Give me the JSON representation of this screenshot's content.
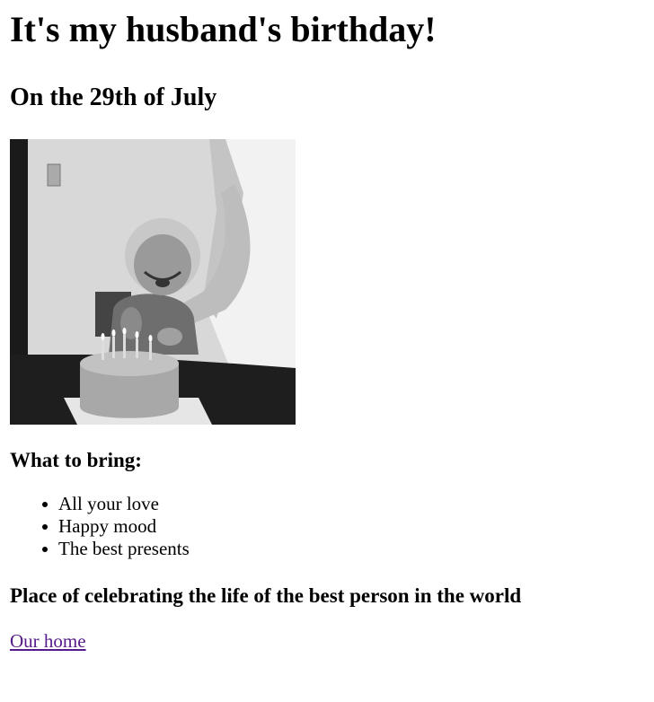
{
  "page": {
    "title": "It's my husband's birthday!",
    "date": "On the 29th of July",
    "photo_alt": "Black and white photo of a crying child in front of a birthday cake with candles",
    "bring_heading": "What to bring:",
    "bring_items": [
      "All your love",
      "Happy mood",
      "The best presents"
    ],
    "place_heading": "Place of celebrating the life of the best person in the world",
    "place_link": "Our home"
  },
  "colors": {
    "text": "#000000",
    "background": "#ffffff",
    "visited_link": "#551a8b"
  }
}
